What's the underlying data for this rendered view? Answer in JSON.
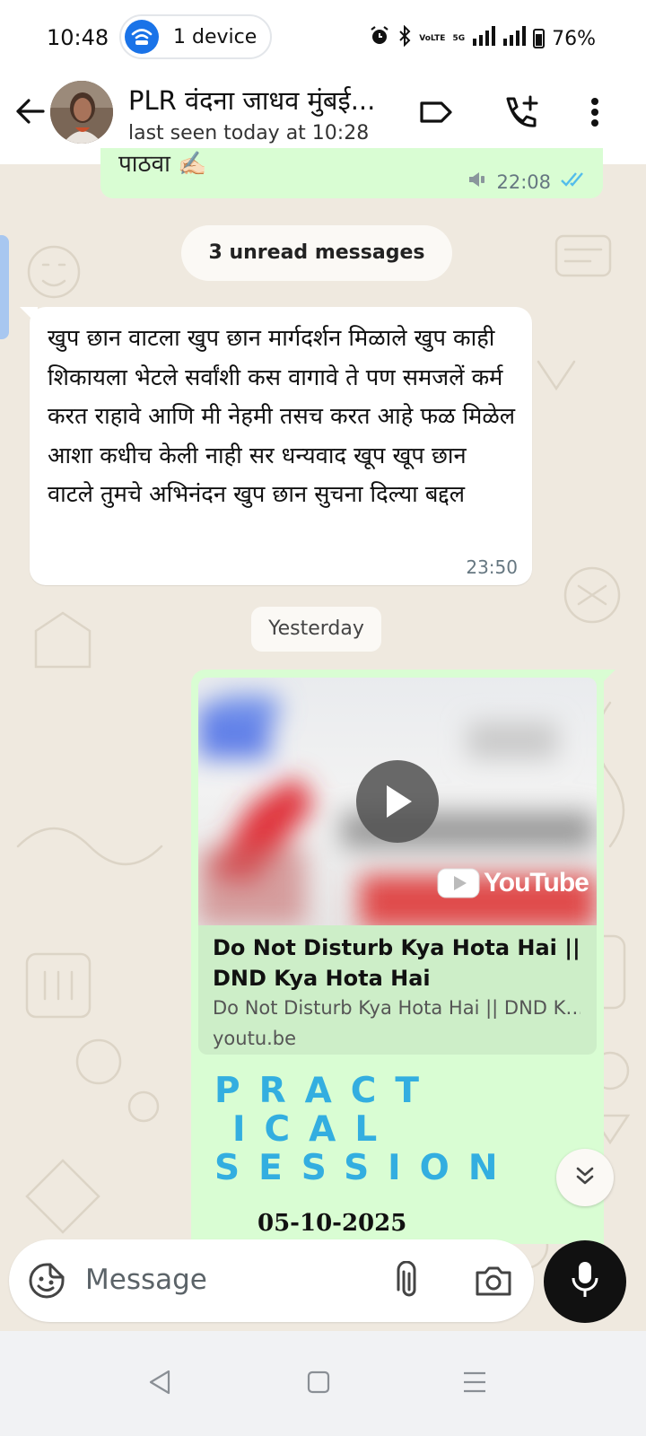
{
  "status_bar": {
    "time": "10:48",
    "device_pill": "1 device",
    "network_small": "VoLTE",
    "network_5g": "5G",
    "battery": "76%"
  },
  "header": {
    "contact_name": "PLR वंदना जाधव मुंबई...",
    "last_seen": "last seen today at 10:28",
    "icons": [
      "back-arrow-icon",
      "label-icon",
      "add-call-icon",
      "more-vert-icon"
    ]
  },
  "messages": {
    "prev_out_peek": "पाठवा ✍🏻",
    "prev_out_time": "22:08",
    "unread_label": "3 unread messages",
    "incoming_text": "खुप छान वाटला खुप छान मार्गदर्शन मिळाले खुप काही शिकायला भेटले सर्वांशी कस वागावे ते पण समजलें कर्म करत राहावे आणि मी नेहमी तसच करत आहे फळ मिळेल आशा कधीच केली नाही सर धन्यवाद खूप खूप छान वाटले तुमचे अभिनंदन खुप छान सुचना दिल्या बद्दल",
    "incoming_time": "23:50",
    "date_divider": "Yesterday",
    "link_preview": {
      "brand": "YouTube",
      "title": "Do Not Disturb Kya Hota Hai || DND Kya Hota Hai",
      "description": "Do Not Disturb Kya Hota Hai || DND K…",
      "host": "youtu.be"
    },
    "image_text": {
      "line1": "PRACT",
      "line2": "ICAL",
      "line3": "SESSION",
      "date": "05-10-2025"
    }
  },
  "composer": {
    "placeholder": "Message"
  },
  "colors": {
    "outgoing_bubble": "#d9fdd3",
    "incoming_bubble": "#ffffff",
    "wallpaper": "#efe9df",
    "read_ticks": "#53bdeb",
    "practical_text": "#33aee0"
  }
}
